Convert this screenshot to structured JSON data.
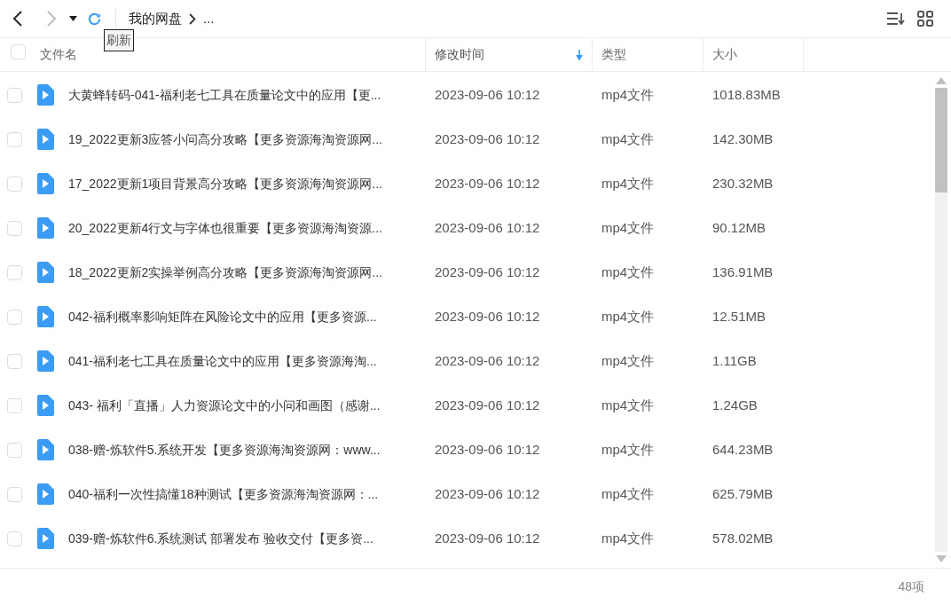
{
  "toolbar": {
    "back_disabled": false,
    "forward_disabled": true,
    "breadcrumb": [
      {
        "label": "我的网盘"
      },
      {
        "label": "..."
      }
    ],
    "tooltip": "刷新"
  },
  "table": {
    "select_all_checked": false,
    "columns": [
      {
        "label": "文件名",
        "sorted": false
      },
      {
        "label": "修改时间",
        "sorted": true
      },
      {
        "label": "类型",
        "sorted": false
      },
      {
        "label": "大小",
        "sorted": false
      }
    ],
    "rows": [
      {
        "name": "大黄蜂转码-041-福利老七工具在质量论文中的应用【更...",
        "modified": "2023-09-06 10:12",
        "type": "mp4文件",
        "size": "1018.83MB",
        "checked": false
      },
      {
        "name": "19_2022更新3应答小问高分攻略【更多资源海淘资源网...",
        "modified": "2023-09-06 10:12",
        "type": "mp4文件",
        "size": "142.30MB",
        "checked": false
      },
      {
        "name": "17_2022更新1项目背景高分攻略【更多资源海淘资源网...",
        "modified": "2023-09-06 10:12",
        "type": "mp4文件",
        "size": "230.32MB",
        "checked": false
      },
      {
        "name": "20_2022更新4行文与字体也很重要【更多资源海淘资源...",
        "modified": "2023-09-06 10:12",
        "type": "mp4文件",
        "size": "90.12MB",
        "checked": false
      },
      {
        "name": "18_2022更新2实操举例高分攻略【更多资源海淘资源网...",
        "modified": "2023-09-06 10:12",
        "type": "mp4文件",
        "size": "136.91MB",
        "checked": false
      },
      {
        "name": "042-福利概率影响矩阵在风险论文中的应用【更多资源...",
        "modified": "2023-09-06 10:12",
        "type": "mp4文件",
        "size": "12.51MB",
        "checked": false
      },
      {
        "name": "041-福利老七工具在质量论文中的应用【更多资源海淘...",
        "modified": "2023-09-06 10:12",
        "type": "mp4文件",
        "size": "1.11GB",
        "checked": false
      },
      {
        "name": "043- 福利「直播」人力资源论文中的小问和画图（感谢...",
        "modified": "2023-09-06 10:12",
        "type": "mp4文件",
        "size": "1.24GB",
        "checked": false
      },
      {
        "name": "038-赠-炼软件5.系统开发【更多资源海淘资源网：www...",
        "modified": "2023-09-06 10:12",
        "type": "mp4文件",
        "size": "644.23MB",
        "checked": false
      },
      {
        "name": "040-福利一次性搞懂18种测试【更多资源海淘资源网：...",
        "modified": "2023-09-06 10:12",
        "type": "mp4文件",
        "size": "625.79MB",
        "checked": false
      },
      {
        "name": "039-赠-炼软件6.系统测试  部署发布  验收交付【更多资...",
        "modified": "2023-09-06 10:12",
        "type": "mp4文件",
        "size": "578.02MB",
        "checked": false
      }
    ]
  },
  "status_bar": {
    "count": "48项"
  }
}
